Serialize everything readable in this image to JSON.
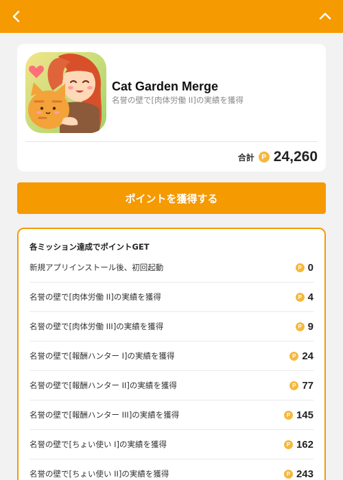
{
  "colors": {
    "accent": "#f59a00",
    "coin": "#f5b83c",
    "background": "#f2f2f2"
  },
  "header": {
    "back_icon": "chevron-left-icon",
    "collapse_icon": "chevron-up-icon"
  },
  "app": {
    "name": "Cat Garden Merge",
    "subtitle": "名誉の壁で[肉体労働 II]の実績を獲得",
    "total_label": "合計",
    "total_points": "24,260",
    "coin_symbol": "P"
  },
  "cta": {
    "label": "ポイントを獲得する"
  },
  "missions": {
    "heading": "各ミッション達成でポイントGET",
    "items": [
      {
        "label": "新規アプリインストール後、初回起動",
        "points": "0"
      },
      {
        "label": "名誉の壁で[肉体労働 II]の実績を獲得",
        "points": "4"
      },
      {
        "label": "名誉の壁で[肉体労働 III]の実績を獲得",
        "points": "9"
      },
      {
        "label": "名誉の壁で[報酬ハンター I]の実績を獲得",
        "points": "24"
      },
      {
        "label": "名誉の壁で[報酬ハンター II]の実績を獲得",
        "points": "77"
      },
      {
        "label": "名誉の壁で[報酬ハンター III]の実績を獲得",
        "points": "145"
      },
      {
        "label": "名誉の壁で[ちょい使い I]の実績を獲得",
        "points": "162"
      },
      {
        "label": "名誉の壁で[ちょい使い II]の実績を獲得",
        "points": "243"
      }
    ]
  }
}
